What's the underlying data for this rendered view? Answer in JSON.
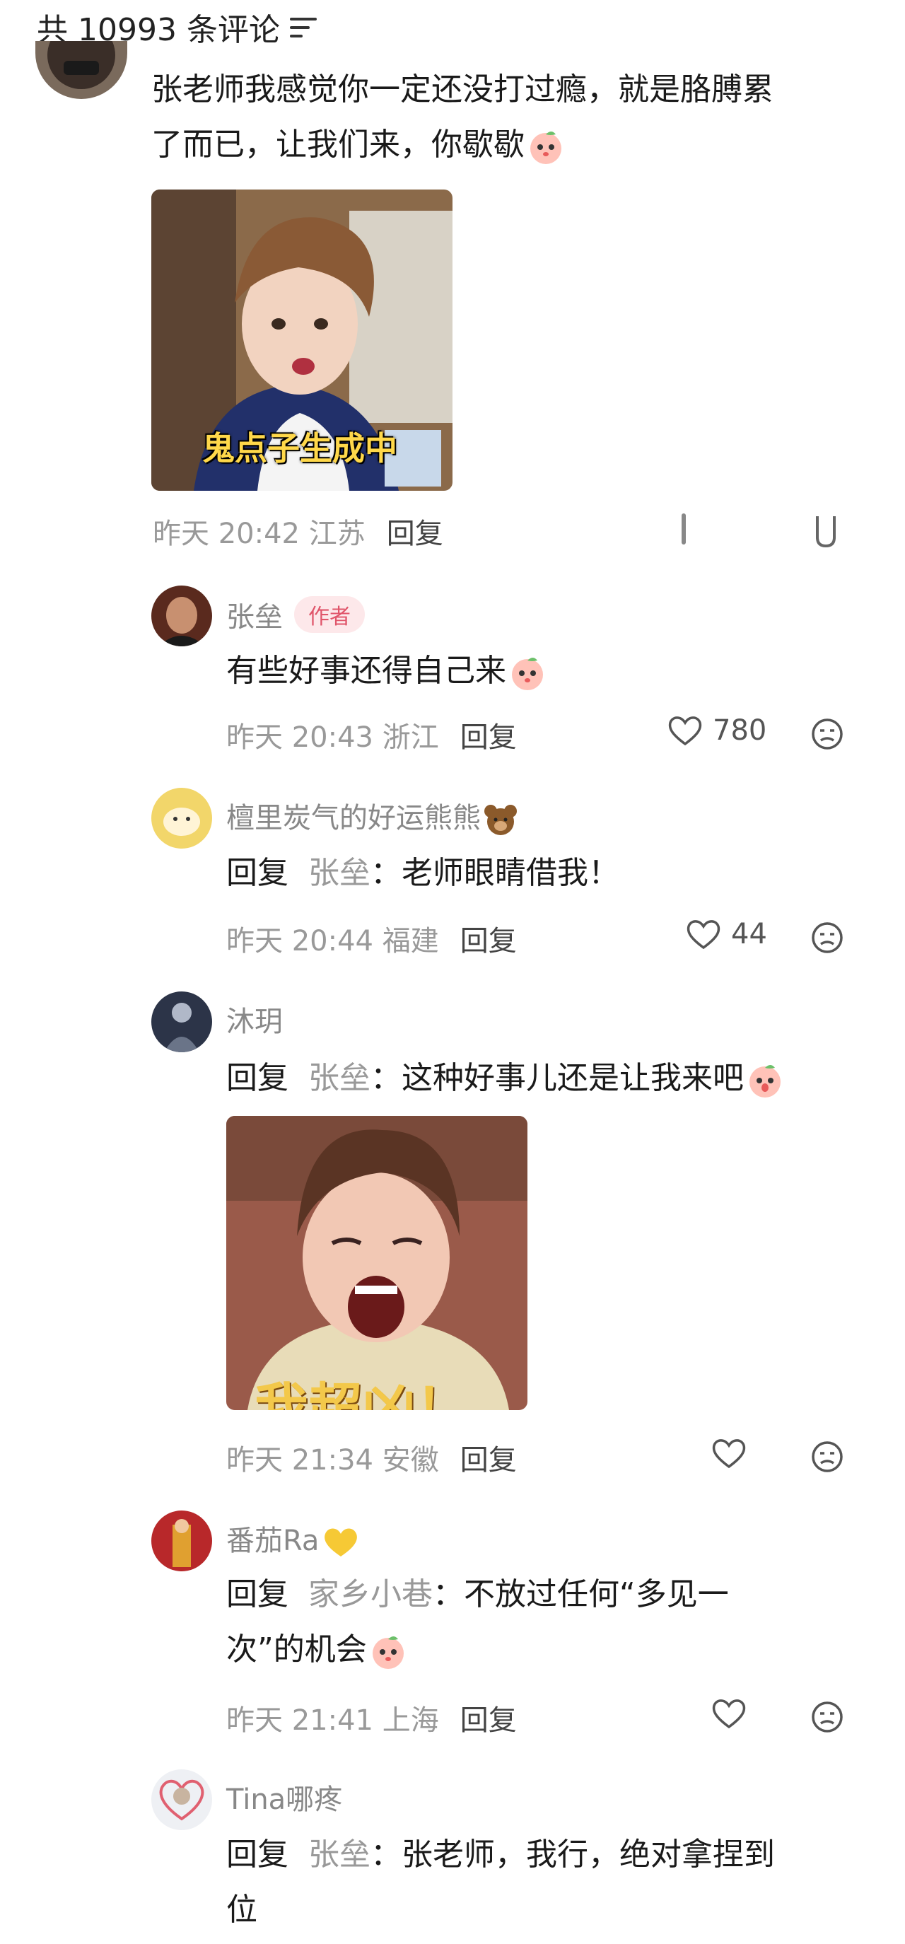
{
  "header": {
    "title": "共 10993 条评论"
  },
  "top_comment": {
    "text_line1": "张老师我感觉你一定还没打过瘾，就是胳膊累",
    "text_line2": "了而已，让我们来，你歇歇",
    "image_caption": "鬼点子生成中",
    "time": "昨天 20:42 江苏",
    "reply_label": "回复"
  },
  "replies": [
    {
      "name": "张垒",
      "badge": "作者",
      "text": "有些好事还得自己来",
      "time": "昨天 20:43 浙江",
      "reply_label": "回复",
      "likes": "780"
    },
    {
      "name": "檀里炭气的好运熊熊",
      "prefix": "回复",
      "target": "张垒",
      "text": "：老师眼睛借我！",
      "time": "昨天 20:44 福建",
      "reply_label": "回复",
      "likes": "44"
    },
    {
      "name": "沐玥",
      "prefix": "回复",
      "target": "张垒",
      "text": "：这种好事儿还是让我来吧",
      "image_caption": "我超凶！",
      "time": "昨天 21:34 安徽",
      "reply_label": "回复",
      "likes": ""
    },
    {
      "name": "番茄Ra",
      "prefix": "回复",
      "target": "家乡小巷",
      "text": "：不放过任何“多见一",
      "text_line2": "次”的机会",
      "time": "昨天 21:41 上海",
      "reply_label": "回复",
      "likes": ""
    },
    {
      "name": "Tina哪疼",
      "prefix": "回复",
      "target": "张垒",
      "text": "：张老师，我行，绝对拿捏到",
      "text_line2": "位"
    }
  ],
  "colors": {
    "meta_gray": "#999999",
    "badge_red": "#e0556a",
    "caption_yellow": "#ffd84a"
  }
}
